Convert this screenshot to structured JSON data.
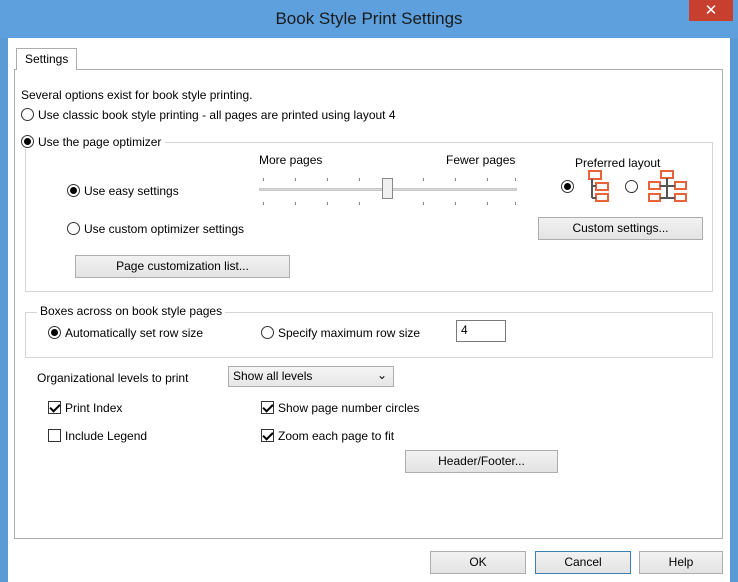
{
  "window": {
    "title": "Book Style Print Settings",
    "close_glyph": "✕"
  },
  "tabs": [
    {
      "label": "Settings"
    }
  ],
  "intro_text": "Several options exist for book style printing.",
  "classic_option": {
    "label": "Use classic book style printing - all pages are printed using layout 4",
    "checked": false
  },
  "optimizer": {
    "label": "Use the page optimizer",
    "checked": true,
    "more_pages_label": "More pages",
    "fewer_pages_label": "Fewer pages",
    "slider_value": 0.5,
    "easy_settings_label": "Use easy settings",
    "easy_checked": true,
    "custom_optimizer_label": "Use custom optimizer settings",
    "custom_checked": false,
    "preferred_layout_label": "Preferred layout",
    "layout_options": [
      {
        "icon": "vertical-layout-icon",
        "checked": true
      },
      {
        "icon": "horizontal-layout-icon",
        "checked": false
      }
    ],
    "custom_settings_button": "Custom settings...",
    "page_customization_button": "Page customization list..."
  },
  "boxes_across": {
    "group_label": "Boxes across on book style pages",
    "auto_label": "Automatically set row size",
    "auto_checked": true,
    "specify_label": "Specify maximum row size",
    "specify_checked": false,
    "row_size_value": "4"
  },
  "levels": {
    "label": "Organizational levels to print",
    "selected": "Show all levels"
  },
  "checkboxes": {
    "print_index": {
      "label": "Print Index",
      "checked": true
    },
    "include_legend": {
      "label": "Include Legend",
      "checked": false
    },
    "page_number_circles": {
      "label": "Show page number circles",
      "checked": true
    },
    "zoom_fit": {
      "label": "Zoom each page to fit",
      "checked": true
    }
  },
  "header_footer_button": "Header/Footer...",
  "footer_buttons": {
    "ok": "OK",
    "cancel": "Cancel",
    "help": "Help"
  },
  "colors": {
    "titlebar": "#5ea0dd",
    "close": "#c7402f",
    "layout_icon": "#e8623a"
  }
}
